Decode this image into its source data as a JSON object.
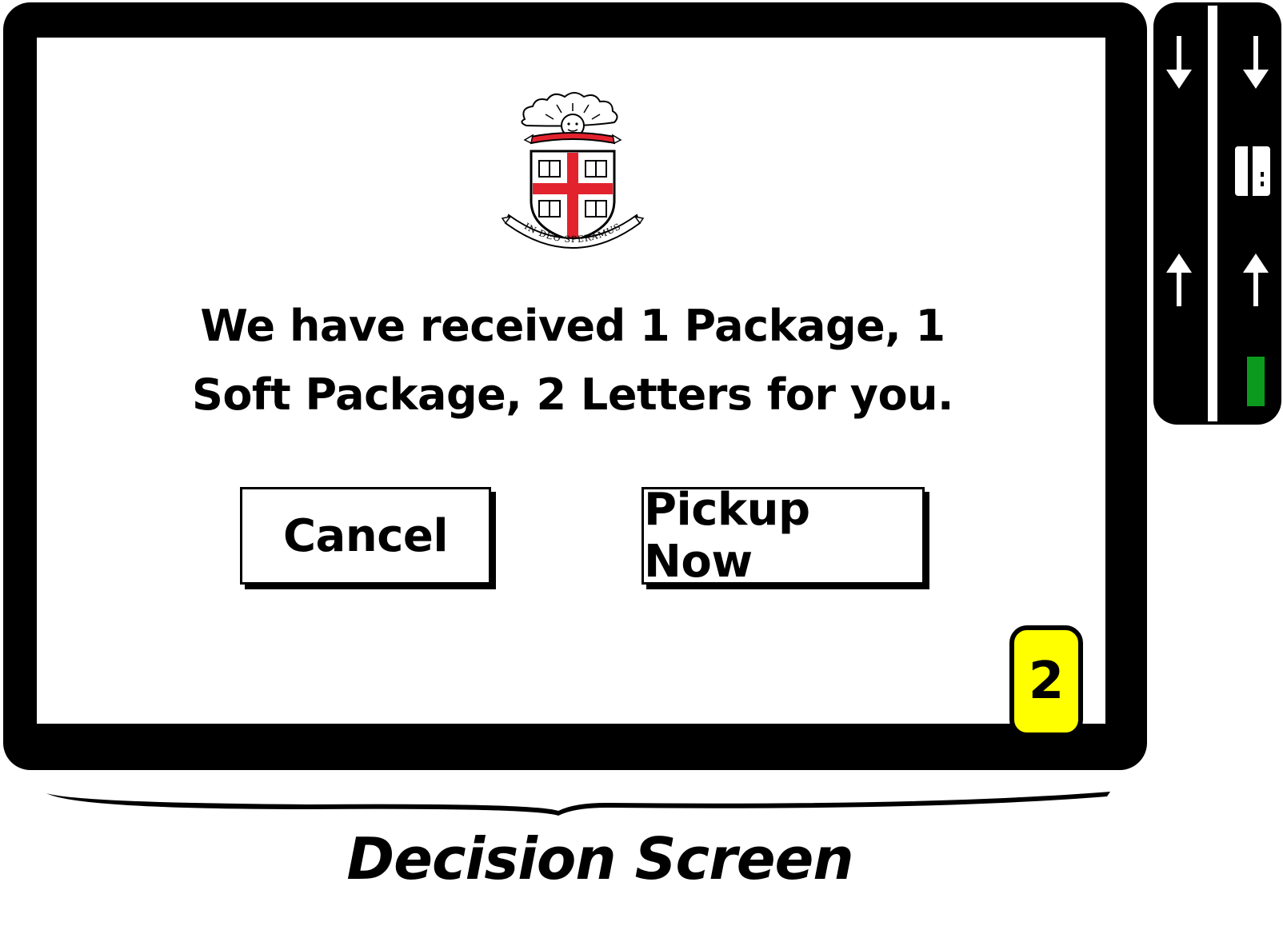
{
  "screen": {
    "logo": {
      "name": "university-crest",
      "motto": "IN DEO SPERAMUS",
      "colors": {
        "cross": "#e2232e",
        "outline": "#000000"
      }
    },
    "message": "We have received 1 Package, 1 Soft Package, 2 Letters for you.",
    "buttons": {
      "cancel_label": "Cancel",
      "pickup_label": "Pickup Now"
    },
    "step_badge": {
      "label": "2",
      "color": "#ffff00"
    }
  },
  "side_panel": {
    "icons": [
      "arrow-down-icon",
      "arrow-down-icon",
      "card-slot-icon",
      "arrow-up-icon",
      "arrow-up-icon"
    ],
    "indicator_color": "#0b9a1e"
  },
  "caption": "Decision Screen"
}
